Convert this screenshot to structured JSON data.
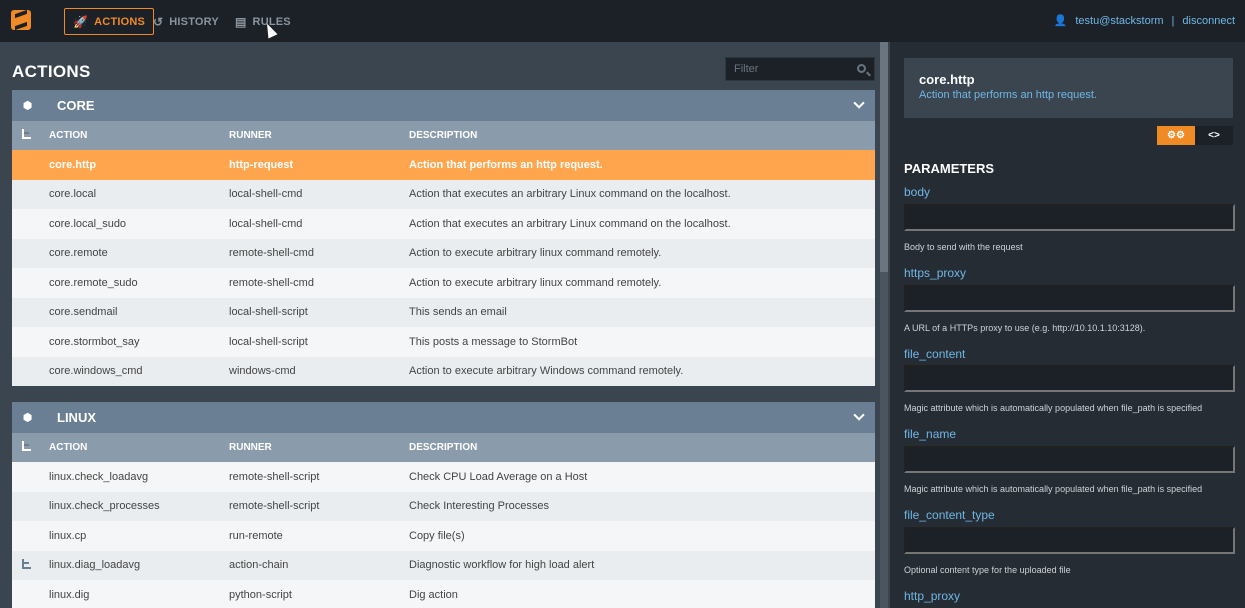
{
  "nav": {
    "actions": "ACTIONS",
    "history": "HISTORY",
    "rules": "RULES"
  },
  "user": {
    "name": "testu@stackstorm",
    "separator": "|",
    "disconnect": "disconnect"
  },
  "page": {
    "title": "ACTIONS",
    "filter_placeholder": "Filter"
  },
  "columns": {
    "action": "ACTION",
    "runner": "RUNNER",
    "description": "DESCRIPTION"
  },
  "packs": [
    {
      "name": "CORE",
      "rows": [
        {
          "action": "core.http",
          "runner": "http-request",
          "description": "Action that performs an http request."
        },
        {
          "action": "core.local",
          "runner": "local-shell-cmd",
          "description": "Action that executes an arbitrary Linux command on the localhost."
        },
        {
          "action": "core.local_sudo",
          "runner": "local-shell-cmd",
          "description": "Action that executes an arbitrary Linux command on the localhost."
        },
        {
          "action": "core.remote",
          "runner": "remote-shell-cmd",
          "description": "Action to execute arbitrary linux command remotely."
        },
        {
          "action": "core.remote_sudo",
          "runner": "remote-shell-cmd",
          "description": "Action to execute arbitrary linux command remotely."
        },
        {
          "action": "core.sendmail",
          "runner": "local-shell-script",
          "description": "This sends an email"
        },
        {
          "action": "core.stormbot_say",
          "runner": "local-shell-script",
          "description": "This posts a message to StormBot"
        },
        {
          "action": "core.windows_cmd",
          "runner": "windows-cmd",
          "description": "Action to execute arbitrary Windows command remotely."
        }
      ]
    },
    {
      "name": "LINUX",
      "rows": [
        {
          "action": "linux.check_loadavg",
          "runner": "remote-shell-script",
          "description": "Check CPU Load Average on a Host"
        },
        {
          "action": "linux.check_processes",
          "runner": "remote-shell-script",
          "description": "Check Interesting Processes"
        },
        {
          "action": "linux.cp",
          "runner": "run-remote",
          "description": "Copy file(s)"
        },
        {
          "action": "linux.diag_loadavg",
          "runner": "action-chain",
          "description": "Diagnostic workflow for high load alert"
        },
        {
          "action": "linux.dig",
          "runner": "python-script",
          "description": "Dig action"
        }
      ]
    }
  ],
  "detail": {
    "name": "core.http",
    "description": "Action that performs an http request.",
    "parameters_title": "PARAMETERS",
    "params": [
      {
        "label": "body",
        "help": "Body to send with the request"
      },
      {
        "label": "https_proxy",
        "help": "A URL of a HTTPs proxy to use (e.g. http://10.10.1.10:3128)."
      },
      {
        "label": "file_content",
        "help": "Magic attribute which is automatically populated when file_path is specified"
      },
      {
        "label": "file_name",
        "help": "Magic attribute which is automatically populated when file_path is specified"
      },
      {
        "label": "file_content_type",
        "help": "Optional content type for the uploaded file"
      },
      {
        "label": "http_proxy",
        "help": ""
      }
    ],
    "code_toggle": "<>"
  },
  "colors": {
    "accent": "#f08a24",
    "selected_row": "#ffa54d",
    "link": "#6fb7e6"
  }
}
